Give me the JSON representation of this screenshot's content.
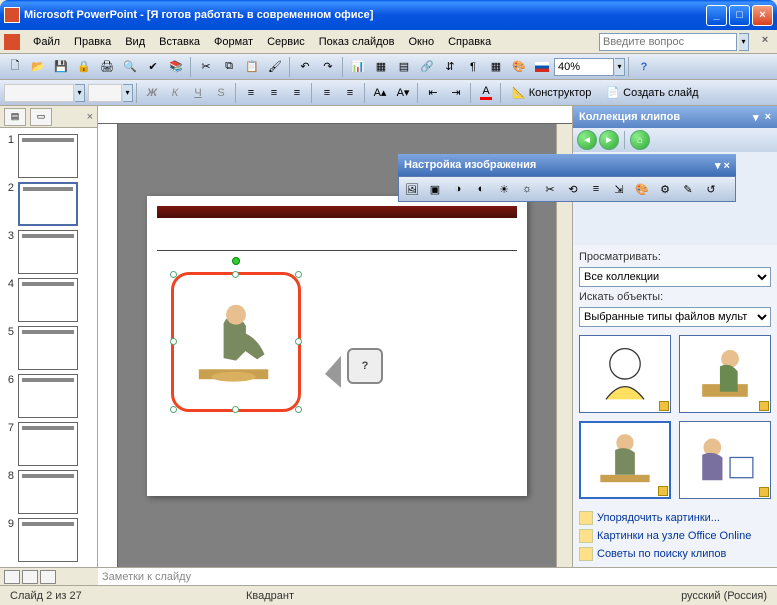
{
  "window": {
    "app": "Microsoft PowerPoint",
    "doc": "[Я готов работать в современном офисе]"
  },
  "menu": {
    "file": "Файл",
    "edit": "Правка",
    "view": "Вид",
    "insert": "Вставка",
    "format": "Формат",
    "tools": "Сервис",
    "slideshow": "Показ слайдов",
    "window": "Окно",
    "help": "Справка"
  },
  "askbox": {
    "placeholder": "Введите вопрос"
  },
  "toolbar": {
    "zoom": "40%",
    "designer": "Конструктор",
    "newslide": "Создать слайд"
  },
  "picture_toolbar": {
    "title": "Настройка изображения"
  },
  "clipart_panel": {
    "title": "Коллекция клипов",
    "browse_label": "Просматривать:",
    "browse_value": "Все коллекции",
    "search_label": "Искать объекты:",
    "search_value": "Выбранные типы файлов мульт",
    "links": {
      "organize": "Упорядочить картинки...",
      "online": "Картинки на узле Office Online",
      "tips": "Советы по поиску клипов"
    }
  },
  "slide_callout": "?",
  "thumbnails": [
    {
      "n": "1"
    },
    {
      "n": "2"
    },
    {
      "n": "3"
    },
    {
      "n": "4"
    },
    {
      "n": "5"
    },
    {
      "n": "6"
    },
    {
      "n": "7"
    },
    {
      "n": "8"
    },
    {
      "n": "9"
    }
  ],
  "notes": {
    "placeholder": "Заметки к слайду"
  },
  "status": {
    "slide": "Слайд 2 из 27",
    "placeholder": "Квадрант",
    "lang": "русский (Россия)"
  }
}
